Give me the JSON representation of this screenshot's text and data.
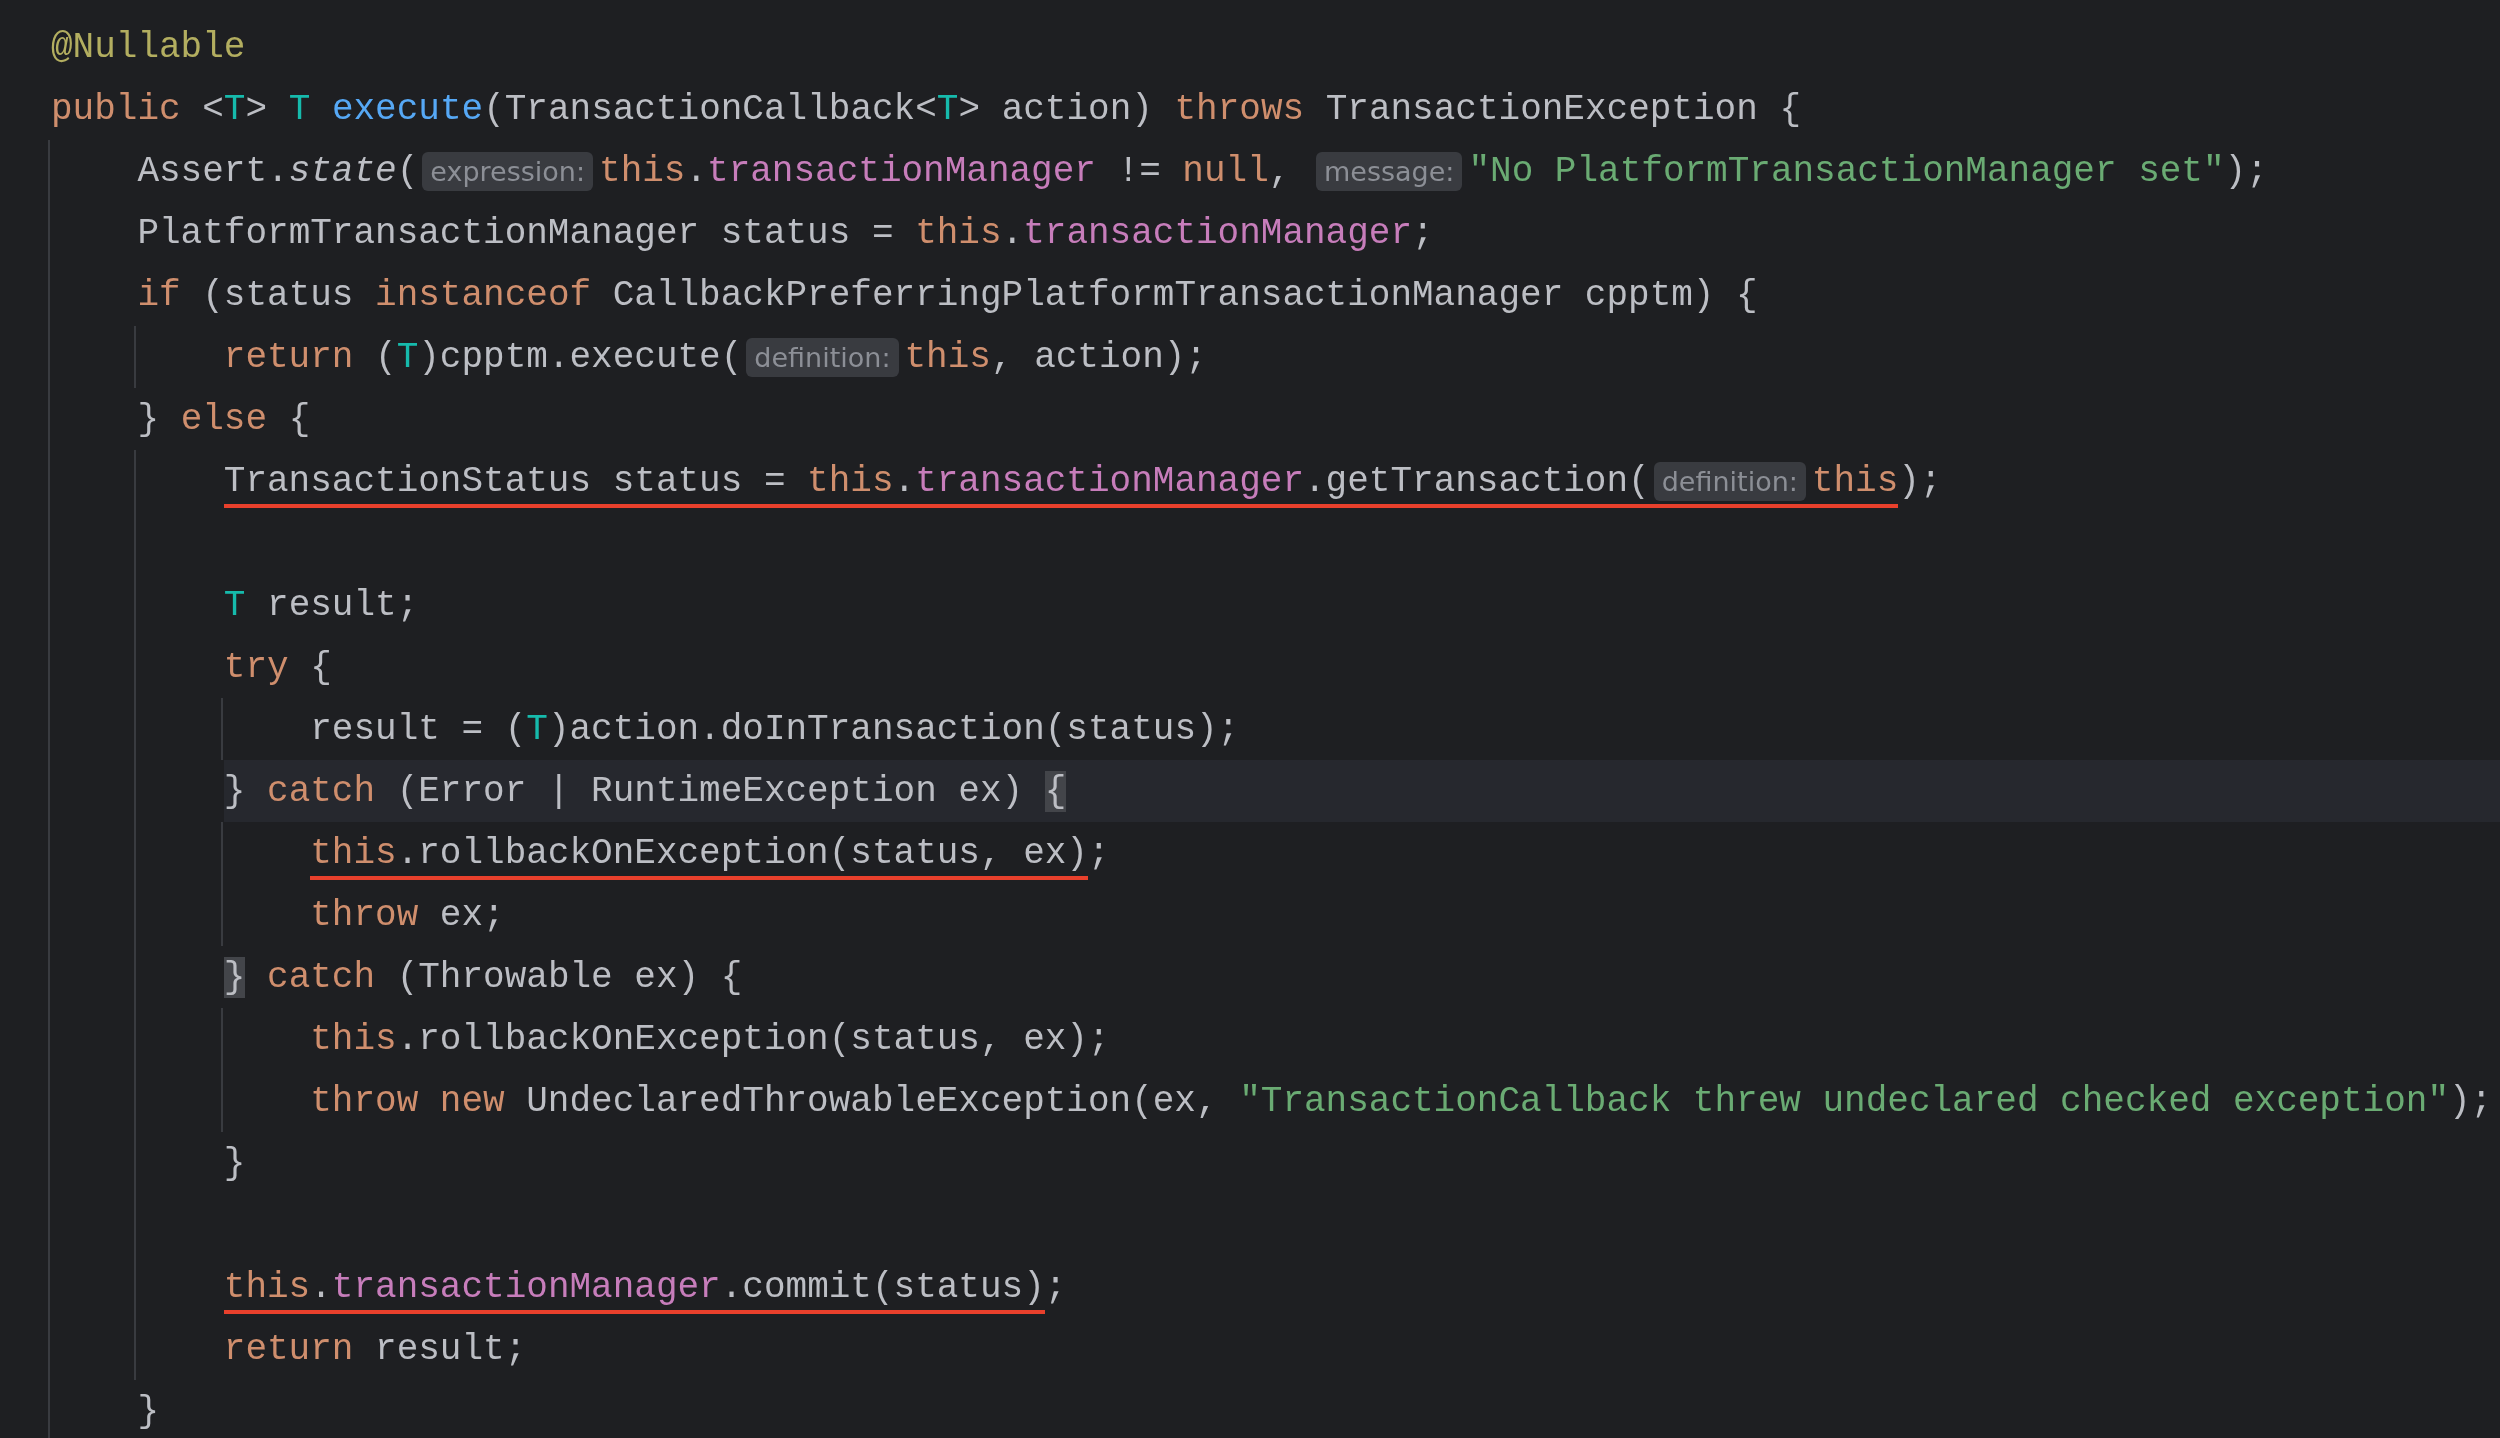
{
  "editor": {
    "lines": [
      {
        "current": false,
        "items": [
          {
            "kind": "annotation",
            "text": "@Nullable"
          }
        ]
      },
      {
        "current": false,
        "items": [
          {
            "kind": "keyword",
            "text": "public "
          },
          {
            "kind": "plain",
            "text": "<"
          },
          {
            "kind": "type_param",
            "text": "T"
          },
          {
            "kind": "plain",
            "text": "> "
          },
          {
            "kind": "type_param",
            "text": "T "
          },
          {
            "kind": "function",
            "text": "execute"
          },
          {
            "kind": "plain",
            "text": "(TransactionCallback<"
          },
          {
            "kind": "type_param",
            "text": "T"
          },
          {
            "kind": "plain",
            "text": "> action) "
          },
          {
            "kind": "keyword",
            "text": "throws "
          },
          {
            "kind": "plain",
            "text": "TransactionException {"
          }
        ],
        "children": [
          {
            "current": false,
            "items": [
              {
                "kind": "plain",
                "text": "Assert."
              },
              {
                "kind": "static",
                "text": "state"
              },
              {
                "kind": "plain",
                "text": "("
              },
              {
                "kind": "hint",
                "text": "expression:"
              },
              {
                "kind": "keyword",
                "text": "this"
              },
              {
                "kind": "plain",
                "text": "."
              },
              {
                "kind": "field",
                "text": "transactionManager"
              },
              {
                "kind": "plain",
                "text": " != "
              },
              {
                "kind": "keyword",
                "text": "null"
              },
              {
                "kind": "plain",
                "text": ", "
              },
              {
                "kind": "hint",
                "text": "message:"
              },
              {
                "kind": "string",
                "text": "\"No PlatformTransactionManager set\""
              },
              {
                "kind": "plain",
                "text": ");"
              }
            ]
          },
          {
            "current": false,
            "items": [
              {
                "kind": "plain",
                "text": "PlatformTransactionManager status = "
              },
              {
                "kind": "keyword",
                "text": "this"
              },
              {
                "kind": "plain",
                "text": "."
              },
              {
                "kind": "field",
                "text": "transactionManager"
              },
              {
                "kind": "plain",
                "text": ";"
              }
            ]
          },
          {
            "current": false,
            "items": [
              {
                "kind": "keyword",
                "text": "if "
              },
              {
                "kind": "plain",
                "text": "(status "
              },
              {
                "kind": "keyword",
                "text": "instanceof "
              },
              {
                "kind": "plain",
                "text": "CallbackPreferringPlatformTransactionManager cpptm) {"
              }
            ],
            "children": [
              {
                "current": false,
                "items": [
                  {
                    "kind": "keyword",
                    "text": "return "
                  },
                  {
                    "kind": "plain",
                    "text": "("
                  },
                  {
                    "kind": "type_param",
                    "text": "T"
                  },
                  {
                    "kind": "plain",
                    "text": ")cpptm.execute("
                  },
                  {
                    "kind": "hint",
                    "text": "definition:"
                  },
                  {
                    "kind": "keyword",
                    "text": "this"
                  },
                  {
                    "kind": "plain",
                    "text": ", action);"
                  }
                ]
              }
            ]
          },
          {
            "current": false,
            "items": [
              {
                "kind": "plain",
                "text": "} "
              },
              {
                "kind": "keyword",
                "text": "else "
              },
              {
                "kind": "plain",
                "text": "{"
              }
            ],
            "children": [
              {
                "current": false,
                "items": [
                  {
                    "kind": "error",
                    "items": [
                      {
                        "kind": "plain",
                        "text": "TransactionStatus status = "
                      },
                      {
                        "kind": "keyword",
                        "text": "this"
                      },
                      {
                        "kind": "plain",
                        "text": "."
                      },
                      {
                        "kind": "field",
                        "text": "transactionManager"
                      },
                      {
                        "kind": "plain",
                        "text": ".getTransaction("
                      },
                      {
                        "kind": "hint",
                        "text": "definition:"
                      },
                      {
                        "kind": "keyword",
                        "text": "this"
                      }
                    ]
                  },
                  {
                    "kind": "plain",
                    "text": ");"
                  }
                ]
              },
              {
                "current": false
              },
              {
                "current": false,
                "items": [
                  {
                    "kind": "type_param",
                    "text": "T "
                  },
                  {
                    "kind": "plain",
                    "text": "result;"
                  }
                ]
              },
              {
                "current": false,
                "items": [
                  {
                    "kind": "keyword",
                    "text": "try "
                  },
                  {
                    "kind": "plain",
                    "text": "{"
                  }
                ],
                "children": [
                  {
                    "current": false,
                    "items": [
                      {
                        "kind": "plain",
                        "text": "result = ("
                      },
                      {
                        "kind": "type_param",
                        "text": "T"
                      },
                      {
                        "kind": "plain",
                        "text": ")action.doInTransaction(status);"
                      }
                    ]
                  }
                ]
              },
              {
                "current": true,
                "items": [
                  {
                    "kind": "plain",
                    "text": "} "
                  },
                  {
                    "kind": "keyword",
                    "text": "catch "
                  },
                  {
                    "kind": "plain",
                    "text": "(Error | RuntimeException ex) "
                  },
                  {
                    "kind": "brace_match",
                    "text": "{"
                  }
                ],
                "children": [
                  {
                    "current": false,
                    "items": [
                      {
                        "kind": "error",
                        "items": [
                          {
                            "kind": "keyword",
                            "text": "this"
                          },
                          {
                            "kind": "plain",
                            "text": ".rollbackOnException(status, ex)"
                          }
                        ]
                      },
                      {
                        "kind": "plain",
                        "text": ";"
                      }
                    ]
                  },
                  {
                    "current": false,
                    "items": [
                      {
                        "kind": "keyword",
                        "text": "throw "
                      },
                      {
                        "kind": "plain",
                        "text": "ex;"
                      }
                    ]
                  }
                ]
              },
              {
                "current": false,
                "items": [
                  {
                    "kind": "brace_match",
                    "text": "}"
                  },
                  {
                    "kind": "keyword",
                    "text": " catch "
                  },
                  {
                    "kind": "plain",
                    "text": "(Throwable ex) {"
                  }
                ],
                "children": [
                  {
                    "current": false,
                    "items": [
                      {
                        "kind": "keyword",
                        "text": "this"
                      },
                      {
                        "kind": "plain",
                        "text": ".rollbackOnException(status, ex);"
                      }
                    ]
                  },
                  {
                    "current": false,
                    "items": [
                      {
                        "kind": "keyword",
                        "text": "throw new "
                      },
                      {
                        "kind": "plain",
                        "text": "UndeclaredThrowableException(ex, "
                      },
                      {
                        "kind": "string",
                        "text": "\"TransactionCallback threw undeclared checked exception\""
                      },
                      {
                        "kind": "plain",
                        "text": ");"
                      }
                    ]
                  }
                ]
              },
              {
                "current": false,
                "items": [
                  {
                    "kind": "plain",
                    "text": "}"
                  }
                ]
              },
              {
                "current": false
              },
              {
                "current": false,
                "items": [
                  {
                    "kind": "error",
                    "items": [
                      {
                        "kind": "keyword",
                        "text": "this"
                      },
                      {
                        "kind": "plain",
                        "text": "."
                      },
                      {
                        "kind": "field",
                        "text": "transactionManager"
                      },
                      {
                        "kind": "plain",
                        "text": ".commit(status)"
                      }
                    ]
                  },
                  {
                    "kind": "plain",
                    "text": ";"
                  }
                ]
              },
              {
                "current": false,
                "items": [
                  {
                    "kind": "keyword",
                    "text": "return "
                  },
                  {
                    "kind": "plain",
                    "text": "result;"
                  }
                ]
              }
            ]
          },
          {
            "current": false,
            "items": [
              {
                "kind": "plain",
                "text": "}"
              }
            ]
          }
        ]
      }
    ]
  }
}
